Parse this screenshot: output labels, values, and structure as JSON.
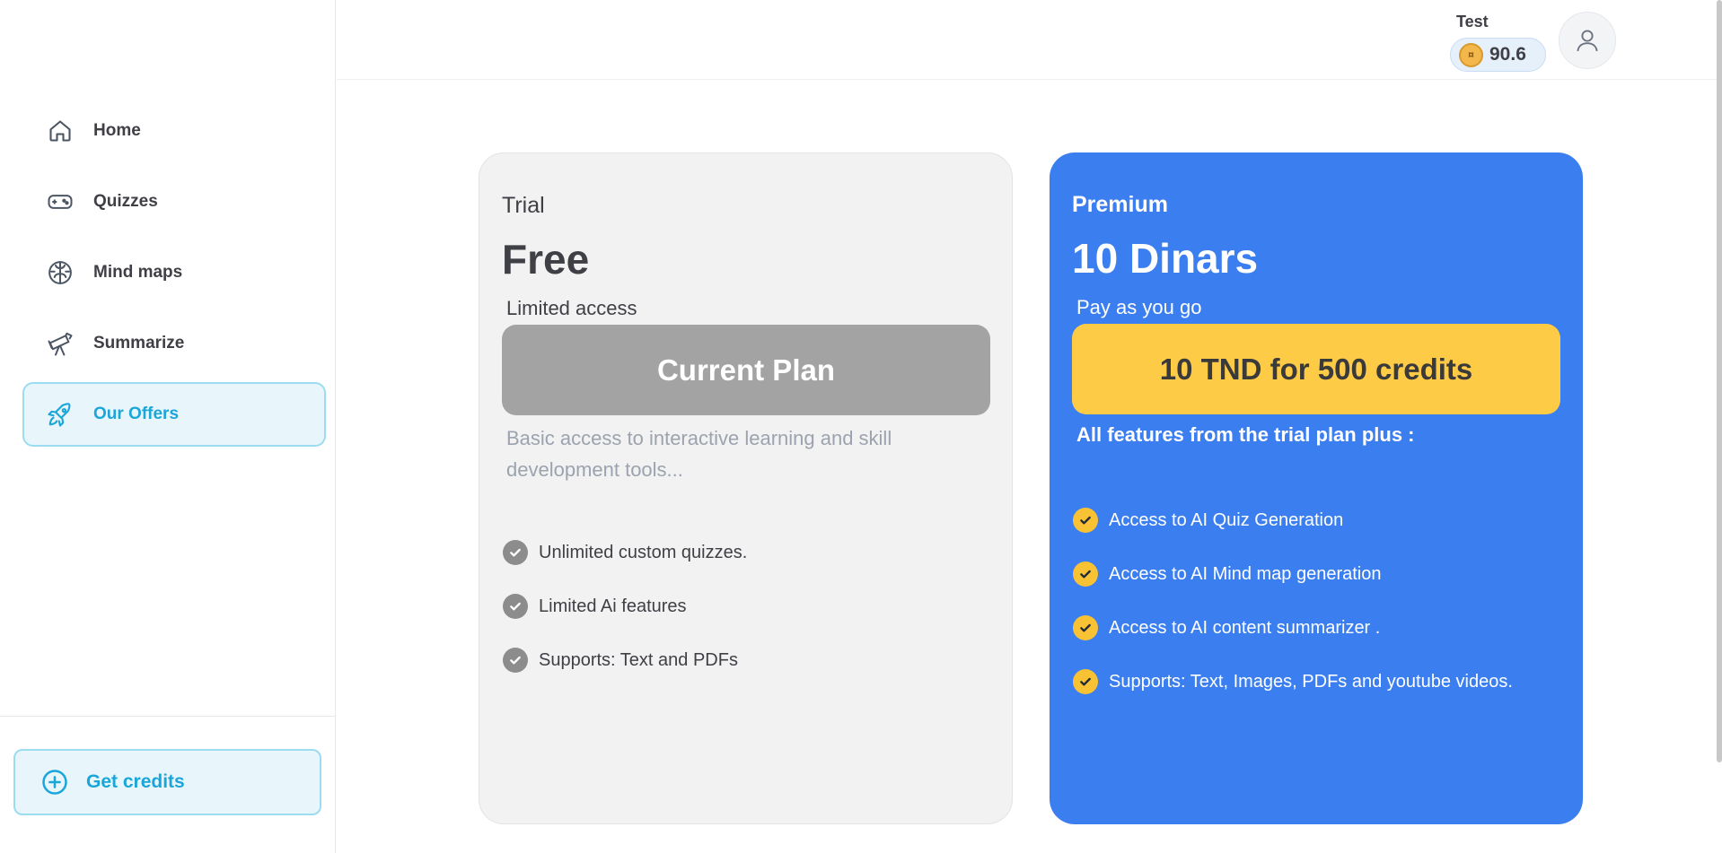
{
  "sidebar": {
    "items": [
      {
        "label": "Home",
        "icon": "home-icon"
      },
      {
        "label": "Quizzes",
        "icon": "gamepad-icon"
      },
      {
        "label": "Mind maps",
        "icon": "brain-icon"
      },
      {
        "label": "Summarize",
        "icon": "telescope-icon"
      },
      {
        "label": "Our Offers",
        "icon": "rocket-icon",
        "active": true
      }
    ],
    "get_credits_label": "Get credits"
  },
  "header": {
    "user_name": "Test",
    "credits": "90.6"
  },
  "plans": {
    "trial": {
      "name": "Trial",
      "price": "Free",
      "subtitle": "Limited access",
      "button": "Current Plan",
      "description": "Basic access to interactive learning and skill development tools...",
      "features": [
        "Unlimited custom quizzes.",
        "Limited Ai features",
        "Supports: Text and PDFs"
      ]
    },
    "premium": {
      "name": "Premium",
      "price": "10 Dinars",
      "subtitle": "Pay as you go",
      "button": "10 TND for 500 credits",
      "description": "All features from the trial plan plus :",
      "features": [
        "Access to AI Quiz Generation",
        "Access to AI Mind map generation",
        "Access to AI content summarizer .",
        "Supports: Text, Images, PDFs and youtube videos."
      ]
    }
  },
  "colors": {
    "accent": "#1aa6d8",
    "premium_bg": "#3b7ef0",
    "premium_button": "#fecb47",
    "trial_button": "#a3a3a3"
  }
}
